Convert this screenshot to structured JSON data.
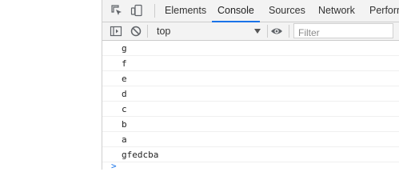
{
  "devtools": {
    "tabs": [
      {
        "label": "Elements"
      },
      {
        "label": "Console"
      },
      {
        "label": "Sources"
      },
      {
        "label": "Network"
      },
      {
        "label": "Perform"
      }
    ],
    "active_tab": "Console",
    "icons": {
      "inspect": "inspect-element-icon",
      "device": "device-toolbar-icon",
      "sidebar": "console-sidebar-icon",
      "clear": "clear-console-icon",
      "eye": "live-expression-icon"
    },
    "context": {
      "value": "top"
    },
    "filter": {
      "placeholder": "Filter",
      "value": ""
    },
    "console_lines": [
      "g",
      "f",
      "e",
      "d",
      "c",
      "b",
      "a",
      "gfedcba"
    ],
    "prompt": ">"
  },
  "colors": {
    "accent": "#1a73e8",
    "toolbar_bg": "#f3f3f3",
    "border": "#cccccc",
    "text": "#333333"
  }
}
